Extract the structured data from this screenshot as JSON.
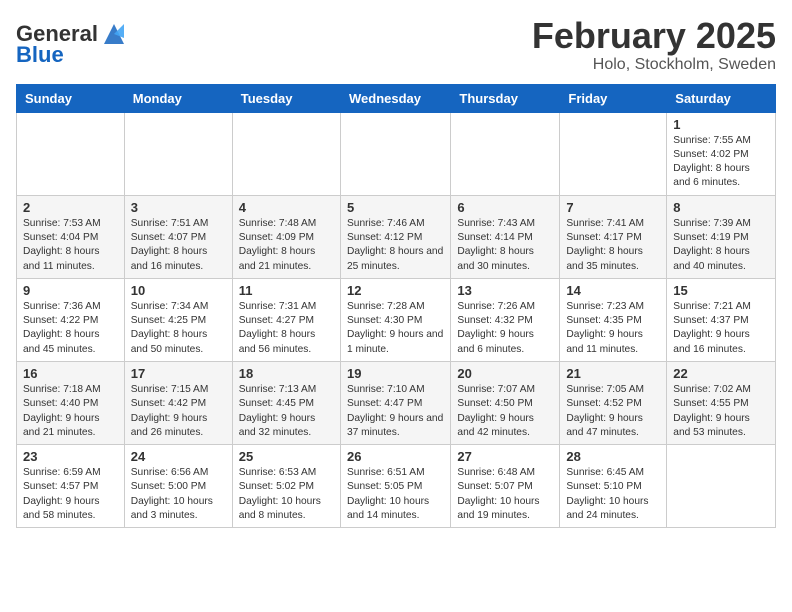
{
  "logo": {
    "general": "General",
    "blue": "Blue"
  },
  "title": "February 2025",
  "location": "Holo, Stockholm, Sweden",
  "weekdays": [
    "Sunday",
    "Monday",
    "Tuesday",
    "Wednesday",
    "Thursday",
    "Friday",
    "Saturday"
  ],
  "weeks": [
    [
      {
        "day": "",
        "info": ""
      },
      {
        "day": "",
        "info": ""
      },
      {
        "day": "",
        "info": ""
      },
      {
        "day": "",
        "info": ""
      },
      {
        "day": "",
        "info": ""
      },
      {
        "day": "",
        "info": ""
      },
      {
        "day": "1",
        "info": "Sunrise: 7:55 AM\nSunset: 4:02 PM\nDaylight: 8 hours and 6 minutes."
      }
    ],
    [
      {
        "day": "2",
        "info": "Sunrise: 7:53 AM\nSunset: 4:04 PM\nDaylight: 8 hours and 11 minutes."
      },
      {
        "day": "3",
        "info": "Sunrise: 7:51 AM\nSunset: 4:07 PM\nDaylight: 8 hours and 16 minutes."
      },
      {
        "day": "4",
        "info": "Sunrise: 7:48 AM\nSunset: 4:09 PM\nDaylight: 8 hours and 21 minutes."
      },
      {
        "day": "5",
        "info": "Sunrise: 7:46 AM\nSunset: 4:12 PM\nDaylight: 8 hours and 25 minutes."
      },
      {
        "day": "6",
        "info": "Sunrise: 7:43 AM\nSunset: 4:14 PM\nDaylight: 8 hours and 30 minutes."
      },
      {
        "day": "7",
        "info": "Sunrise: 7:41 AM\nSunset: 4:17 PM\nDaylight: 8 hours and 35 minutes."
      },
      {
        "day": "8",
        "info": "Sunrise: 7:39 AM\nSunset: 4:19 PM\nDaylight: 8 hours and 40 minutes."
      }
    ],
    [
      {
        "day": "9",
        "info": "Sunrise: 7:36 AM\nSunset: 4:22 PM\nDaylight: 8 hours and 45 minutes."
      },
      {
        "day": "10",
        "info": "Sunrise: 7:34 AM\nSunset: 4:25 PM\nDaylight: 8 hours and 50 minutes."
      },
      {
        "day": "11",
        "info": "Sunrise: 7:31 AM\nSunset: 4:27 PM\nDaylight: 8 hours and 56 minutes."
      },
      {
        "day": "12",
        "info": "Sunrise: 7:28 AM\nSunset: 4:30 PM\nDaylight: 9 hours and 1 minute."
      },
      {
        "day": "13",
        "info": "Sunrise: 7:26 AM\nSunset: 4:32 PM\nDaylight: 9 hours and 6 minutes."
      },
      {
        "day": "14",
        "info": "Sunrise: 7:23 AM\nSunset: 4:35 PM\nDaylight: 9 hours and 11 minutes."
      },
      {
        "day": "15",
        "info": "Sunrise: 7:21 AM\nSunset: 4:37 PM\nDaylight: 9 hours and 16 minutes."
      }
    ],
    [
      {
        "day": "16",
        "info": "Sunrise: 7:18 AM\nSunset: 4:40 PM\nDaylight: 9 hours and 21 minutes."
      },
      {
        "day": "17",
        "info": "Sunrise: 7:15 AM\nSunset: 4:42 PM\nDaylight: 9 hours and 26 minutes."
      },
      {
        "day": "18",
        "info": "Sunrise: 7:13 AM\nSunset: 4:45 PM\nDaylight: 9 hours and 32 minutes."
      },
      {
        "day": "19",
        "info": "Sunrise: 7:10 AM\nSunset: 4:47 PM\nDaylight: 9 hours and 37 minutes."
      },
      {
        "day": "20",
        "info": "Sunrise: 7:07 AM\nSunset: 4:50 PM\nDaylight: 9 hours and 42 minutes."
      },
      {
        "day": "21",
        "info": "Sunrise: 7:05 AM\nSunset: 4:52 PM\nDaylight: 9 hours and 47 minutes."
      },
      {
        "day": "22",
        "info": "Sunrise: 7:02 AM\nSunset: 4:55 PM\nDaylight: 9 hours and 53 minutes."
      }
    ],
    [
      {
        "day": "23",
        "info": "Sunrise: 6:59 AM\nSunset: 4:57 PM\nDaylight: 9 hours and 58 minutes."
      },
      {
        "day": "24",
        "info": "Sunrise: 6:56 AM\nSunset: 5:00 PM\nDaylight: 10 hours and 3 minutes."
      },
      {
        "day": "25",
        "info": "Sunrise: 6:53 AM\nSunset: 5:02 PM\nDaylight: 10 hours and 8 minutes."
      },
      {
        "day": "26",
        "info": "Sunrise: 6:51 AM\nSunset: 5:05 PM\nDaylight: 10 hours and 14 minutes."
      },
      {
        "day": "27",
        "info": "Sunrise: 6:48 AM\nSunset: 5:07 PM\nDaylight: 10 hours and 19 minutes."
      },
      {
        "day": "28",
        "info": "Sunrise: 6:45 AM\nSunset: 5:10 PM\nDaylight: 10 hours and 24 minutes."
      },
      {
        "day": "",
        "info": ""
      }
    ]
  ]
}
